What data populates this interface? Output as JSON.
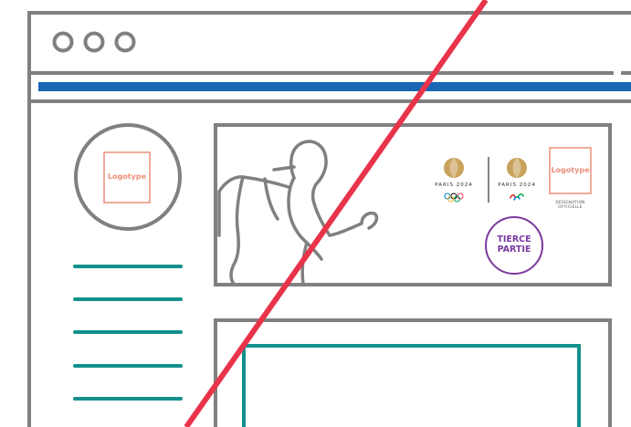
{
  "sidebar": {
    "logo_placeholder": "Logotype",
    "nav_line_count": 5
  },
  "banner": {
    "olympic_label": "PARIS 2024",
    "paralympic_label": "PARIS 2024",
    "partner_logo_placeholder": "Logotype",
    "partner_designation": "DÉSIGNATION OFFICIELLE",
    "third_party_badge": "TIERCE PARTIE"
  },
  "colors": {
    "frame": "#808080",
    "blue_bar": "#1866b4",
    "teal": "#14908c",
    "logo_coral": "#ec8f78",
    "gold": "#c9a25b",
    "purple": "#7b3aa0",
    "red_slash": "#e8334a"
  },
  "icons": [
    "window-dots-icon",
    "runner-silhouette-icon",
    "olympic-rings-icon",
    "paralympic-agitos-icon"
  ]
}
